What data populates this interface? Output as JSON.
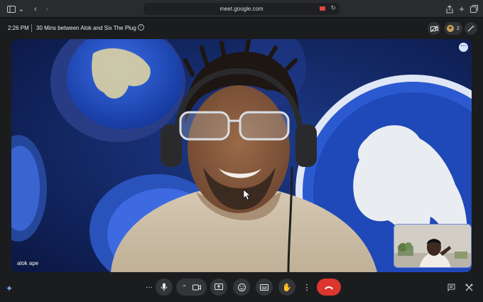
{
  "browser": {
    "url": "meet.google.com",
    "icons": [
      "sidebar-icon",
      "chevron-down-icon",
      "back-icon",
      "forward-icon",
      "camera-recording-icon",
      "reload-icon",
      "share-icon",
      "new-tab-icon",
      "tabs-overview-icon"
    ]
  },
  "meeting": {
    "time": "2:26 PM",
    "title": "30 Mins between Alok and Six The Plug",
    "participant_count": "2"
  },
  "video": {
    "speaker_name": "alok ape"
  },
  "controls": {
    "items": [
      "more-options-icon",
      "microphone-icon",
      "chevron-up-icon",
      "camera-icon",
      "present-screen-icon",
      "emoji-icon",
      "captions-icon",
      "raise-hand-icon",
      "more-vert-icon",
      "end-call-icon"
    ],
    "end_call_color": "#dc362e"
  },
  "accent": "#7aa7ff"
}
